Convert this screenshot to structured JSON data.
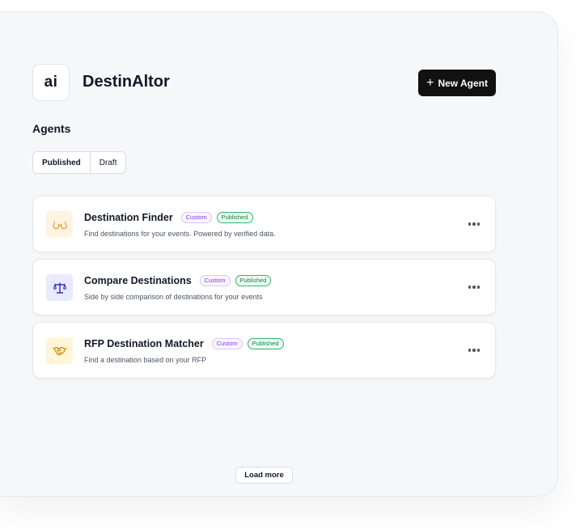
{
  "app": {
    "logo_text": "ai",
    "title": "DestinAltor"
  },
  "toolbar": {
    "new_agent_label": "New Agent",
    "new_agent_icon": "plus-icon"
  },
  "section": {
    "title": "Agents"
  },
  "tabs": [
    {
      "label": "Published",
      "active": true
    },
    {
      "label": "Draft",
      "active": false
    }
  ],
  "agents": [
    {
      "name": "Destination Finder",
      "badges": [
        "Custom",
        "Published"
      ],
      "description": "Find destinations for your events. Powered by verified data.",
      "icon": "glasses-icon",
      "icon_bg": "#fff3e4",
      "icon_color": "#f2a23a"
    },
    {
      "name": "Compare Destinations",
      "badges": [
        "Custom",
        "Published"
      ],
      "description": "Side by side comparison of destinations for your events",
      "icon": "scale-icon",
      "icon_bg": "#e9e9ff",
      "icon_color": "#2f2fc7"
    },
    {
      "name": "RFP Destination Matcher",
      "badges": [
        "Custom",
        "Published"
      ],
      "description": "Find a destination based on your RFP",
      "icon": "handshake-icon",
      "icon_bg": "#fff5d8",
      "icon_color": "#d48a12"
    }
  ],
  "pagination": {
    "load_more_label": "Load more"
  },
  "colors": {
    "panel_bg": "#f6f7f9",
    "primary_button": "#111111",
    "custom_badge": "#7c3aed",
    "published_badge": "#15803d"
  }
}
